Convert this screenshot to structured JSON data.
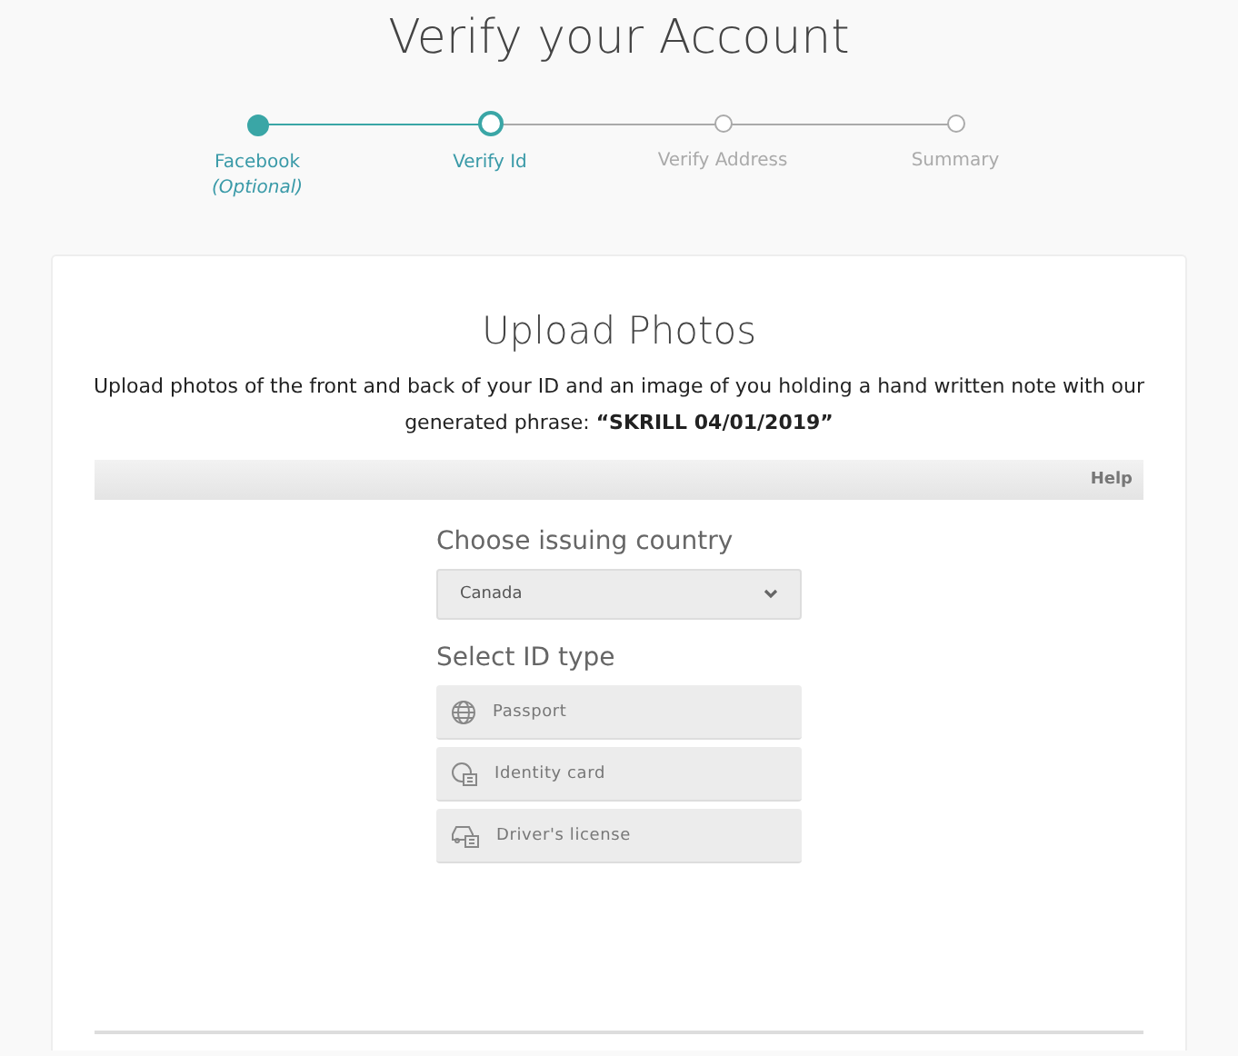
{
  "page_title": "Verify your Account",
  "steps": [
    {
      "label": "Facebook",
      "note": "(Optional)",
      "completed": true,
      "selected": false
    },
    {
      "label": "Verify Id",
      "completed": false,
      "selected": true
    },
    {
      "label": "Verify Address",
      "completed": false,
      "selected": false
    },
    {
      "label": "Summary",
      "completed": false,
      "selected": false
    }
  ],
  "card": {
    "title": "Upload Photos",
    "description": "Upload photos of the front and back of your ID and an image of you holding a hand written note with our generated phrase: **“SKRILL 04/01/2019”**",
    "help": "Help",
    "country_label": "Choose issuing country",
    "country": "Canada",
    "id_label": "Select ID type",
    "id_types": [
      {
        "kind": "passport",
        "label": "Passport"
      },
      {
        "kind": "identity",
        "label": "Identity card"
      },
      {
        "kind": "license",
        "label": "Driver's license"
      }
    ]
  }
}
